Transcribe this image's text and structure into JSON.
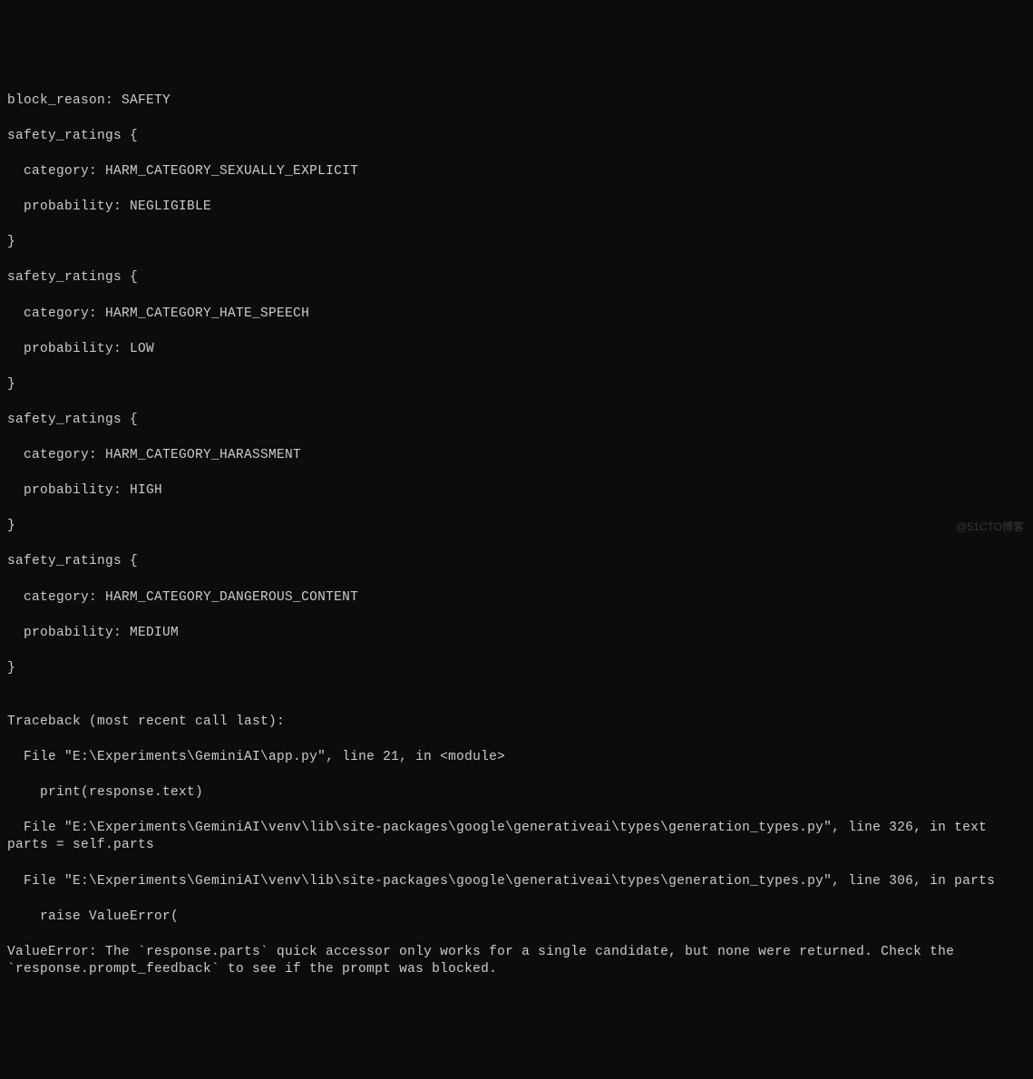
{
  "terminal": {
    "lines": [
      "block_reason: SAFETY",
      "safety_ratings {",
      "  category: HARM_CATEGORY_SEXUALLY_EXPLICIT",
      "  probability: NEGLIGIBLE",
      "}",
      "safety_ratings {",
      "  category: HARM_CATEGORY_HATE_SPEECH",
      "  probability: LOW",
      "}",
      "safety_ratings {",
      "  category: HARM_CATEGORY_HARASSMENT",
      "  probability: HIGH",
      "}",
      "safety_ratings {",
      "  category: HARM_CATEGORY_DANGEROUS_CONTENT",
      "  probability: MEDIUM",
      "}",
      "",
      "Traceback (most recent call last):",
      "  File \"E:\\Experiments\\GeminiAI\\app.py\", line 21, in <module>",
      "    print(response.text)",
      "  File \"E:\\Experiments\\GeminiAI\\venv\\lib\\site-packages\\google\\generativeai\\types\\generation_types.py\", line 326, in text    parts = self.parts",
      "  File \"E:\\Experiments\\GeminiAI\\venv\\lib\\site-packages\\google\\generativeai\\types\\generation_types.py\", line 306, in parts",
      "    raise ValueError(",
      "ValueError: The `response.parts` quick accessor only works for a single candidate, but none were returned. Check the `response.prompt_feedback` to see if the prompt was blocked."
    ]
  },
  "watermark": "@51CTO博客"
}
